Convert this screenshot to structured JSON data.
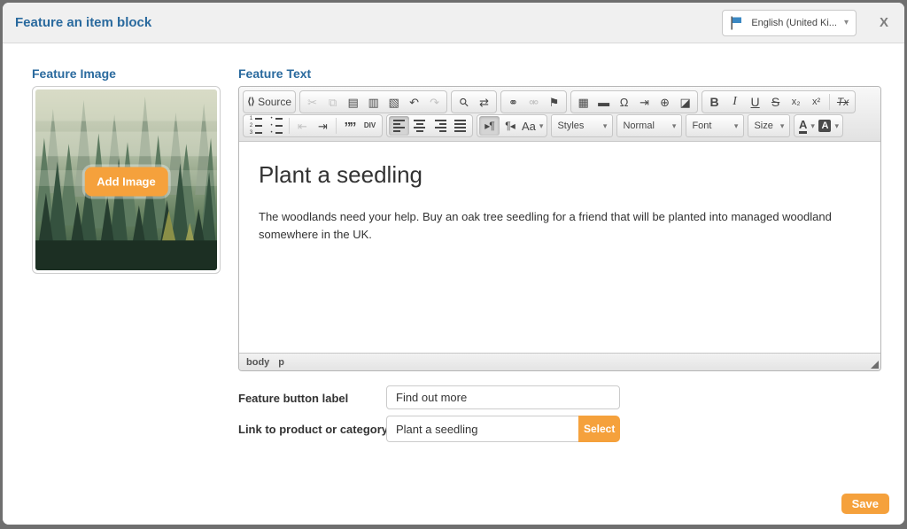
{
  "header": {
    "title": "Feature an item block",
    "language_selector": {
      "value": "English (United Ki...",
      "flag_color": "#3b88c3"
    },
    "close": "X"
  },
  "image_panel": {
    "heading": "Feature Image",
    "add_button": "Add Image"
  },
  "text_panel": {
    "heading": "Feature Text"
  },
  "editor": {
    "caret_glyph": "▾",
    "rows": [
      [
        {
          "name": "document",
          "items": [
            {
              "name": "source",
              "glyph": "⟨⟩",
              "label": "Source"
            }
          ]
        },
        {
          "name": "clipboard",
          "items": [
            {
              "name": "cut",
              "glyph": "✂",
              "disabled": true
            },
            {
              "name": "copy",
              "glyph": "⧉",
              "disabled": true
            },
            {
              "name": "paste",
              "glyph": "▤"
            },
            {
              "name": "paste-text",
              "glyph": "▥"
            },
            {
              "name": "paste-word",
              "glyph": "▧"
            },
            {
              "name": "undo",
              "glyph": "↶"
            },
            {
              "name": "redo",
              "glyph": "↷",
              "disabled": true
            }
          ]
        },
        {
          "name": "find-replace",
          "items": [
            {
              "name": "find",
              "glyph": "⚲"
            },
            {
              "name": "replace",
              "glyph": "⇄"
            }
          ]
        },
        {
          "name": "links",
          "items": [
            {
              "name": "link",
              "glyph": "⚭"
            },
            {
              "name": "unlink",
              "glyph": "⚮",
              "disabled": true
            },
            {
              "name": "anchor",
              "glyph": "⚑"
            }
          ]
        },
        {
          "name": "insert",
          "items": [
            {
              "name": "table",
              "glyph": "▦"
            },
            {
              "name": "horizontal-rule",
              "glyph": "▬"
            },
            {
              "name": "special-char",
              "glyph": "Ω"
            },
            {
              "name": "page-break",
              "glyph": "⇥"
            },
            {
              "name": "iframe",
              "glyph": "⊕"
            },
            {
              "name": "image",
              "glyph": "◪"
            }
          ]
        },
        {
          "name": "basic-styles",
          "items": [
            {
              "name": "bold",
              "glyph": "B"
            },
            {
              "name": "italic",
              "glyph": "I"
            },
            {
              "name": "underline",
              "glyph": "U"
            },
            {
              "name": "strike",
              "glyph": "S"
            },
            {
              "name": "subscript",
              "glyph": "x₂"
            },
            {
              "name": "superscript",
              "glyph": "x²"
            },
            {
              "sep": true
            },
            {
              "name": "remove-format",
              "glyph": "Tx"
            }
          ]
        }
      ],
      [
        {
          "name": "paragraph",
          "items": [
            {
              "name": "numbered-list",
              "glyph": "LIST:num"
            },
            {
              "name": "bullet-list",
              "glyph": "LIST:bul"
            },
            {
              "sep": true
            },
            {
              "name": "outdent",
              "glyph": "⇤",
              "disabled": true
            },
            {
              "name": "indent",
              "glyph": "⇥"
            },
            {
              "sep": true
            },
            {
              "name": "blockquote",
              "glyph": "””"
            },
            {
              "name": "div-container",
              "glyph": "DIV",
              "tiny": true
            }
          ]
        },
        {
          "name": "alignment",
          "items": [
            {
              "name": "align-left",
              "glyph": "BARS:left",
              "active": true
            },
            {
              "name": "align-center",
              "glyph": "BARS:center"
            },
            {
              "name": "align-right",
              "glyph": "BARS:right"
            },
            {
              "name": "align-justify",
              "glyph": "BARS:justify"
            }
          ]
        },
        {
          "name": "bidi",
          "items": [
            {
              "name": "ltr",
              "glyph": "▸¶",
              "active": true
            },
            {
              "name": "rtl",
              "glyph": "¶◂"
            },
            {
              "name": "language",
              "glyph": "Aa",
              "caret": true
            }
          ]
        },
        {
          "name": "styles-dd",
          "frameless": true,
          "items": [
            {
              "name": "styles-dropdown",
              "dd": true,
              "label": "Styles"
            }
          ]
        },
        {
          "name": "format-dd",
          "frameless": true,
          "items": [
            {
              "name": "format-dropdown",
              "dd": true,
              "label": "Normal"
            }
          ]
        },
        {
          "name": "font-dd",
          "frameless": true,
          "items": [
            {
              "name": "font-dropdown",
              "dd": true,
              "label": "Font"
            }
          ]
        },
        {
          "name": "size-dd",
          "frameless": true,
          "items": [
            {
              "name": "size-dropdown",
              "dd": true,
              "label": "Size"
            }
          ]
        },
        {
          "name": "colors",
          "items": [
            {
              "name": "text-color",
              "glyph": "A",
              "caret": true
            },
            {
              "name": "bg-color",
              "glyph": "A",
              "caret": true
            }
          ]
        }
      ]
    ],
    "content": {
      "heading": "Plant a seedling",
      "paragraph": "The woodlands need your help. Buy an oak tree seedling for a friend that will be planted into managed woodland somewhere in the UK."
    },
    "status_path": [
      "body",
      "p"
    ]
  },
  "form": {
    "rows": [
      {
        "label": "Feature button label",
        "value": "Find out more"
      },
      {
        "label": "Link to product or category",
        "value": "Plant a seedling",
        "button": "Select"
      }
    ]
  },
  "footer": {
    "save": "Save"
  },
  "colors": {
    "accent_orange": "#f5a13c",
    "heading_blue": "#2a6a9e",
    "flag_blue": "#3b88c3"
  }
}
